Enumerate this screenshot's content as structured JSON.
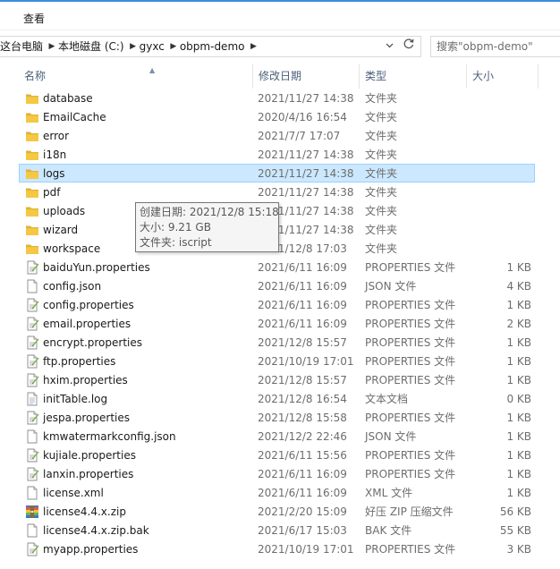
{
  "menubar": {
    "view_label": "查看"
  },
  "address_bar": {
    "crumbs": [
      "这台电脑",
      "本地磁盘 (C:)",
      "gyxc",
      "obpm-demo"
    ]
  },
  "search": {
    "placeholder": "搜索\"obpm-demo\""
  },
  "columns": {
    "name": "名称",
    "date": "修改日期",
    "type": "类型",
    "size": "大小"
  },
  "files": [
    {
      "name": "database",
      "date": "2021/11/27 14:38",
      "type": "文件夹",
      "size": "",
      "icon": "folder-icon"
    },
    {
      "name": "EmailCache",
      "date": "2020/4/16 16:54",
      "type": "文件夹",
      "size": "",
      "icon": "folder-icon"
    },
    {
      "name": "error",
      "date": "2021/7/7 17:07",
      "type": "文件夹",
      "size": "",
      "icon": "folder-icon"
    },
    {
      "name": "i18n",
      "date": "2021/11/27 14:38",
      "type": "文件夹",
      "size": "",
      "icon": "folder-icon"
    },
    {
      "name": "logs",
      "date": "2021/11/27 14:38",
      "type": "文件夹",
      "size": "",
      "icon": "folder-icon",
      "selected": true
    },
    {
      "name": "pdf",
      "date": "2021/11/27 14:38",
      "type": "文件夹",
      "size": "",
      "icon": "folder-icon"
    },
    {
      "name": "uploads",
      "date": "2021/11/27 14:38",
      "type": "文件夹",
      "size": "",
      "icon": "folder-icon"
    },
    {
      "name": "wizard",
      "date": "2021/11/27 14:38",
      "type": "文件夹",
      "size": "",
      "icon": "folder-icon"
    },
    {
      "name": "workspace",
      "date": "2021/12/8 17:03",
      "type": "文件夹",
      "size": "",
      "icon": "folder-icon"
    },
    {
      "name": "baiduYun.properties",
      "date": "2021/6/11 16:09",
      "type": "PROPERTIES 文件",
      "size": "1 KB",
      "icon": "properties-file-icon"
    },
    {
      "name": "config.json",
      "date": "2021/6/11 16:09",
      "type": "JSON 文件",
      "size": "4 KB",
      "icon": "blank-file-icon"
    },
    {
      "name": "config.properties",
      "date": "2021/6/11 16:09",
      "type": "PROPERTIES 文件",
      "size": "1 KB",
      "icon": "properties-file-icon"
    },
    {
      "name": "email.properties",
      "date": "2021/6/11 16:09",
      "type": "PROPERTIES 文件",
      "size": "2 KB",
      "icon": "properties-file-icon"
    },
    {
      "name": "encrypt.properties",
      "date": "2021/12/8 15:57",
      "type": "PROPERTIES 文件",
      "size": "1 KB",
      "icon": "properties-file-icon"
    },
    {
      "name": "ftp.properties",
      "date": "2021/10/19 17:01",
      "type": "PROPERTIES 文件",
      "size": "1 KB",
      "icon": "properties-file-icon"
    },
    {
      "name": "hxim.properties",
      "date": "2021/12/8 15:57",
      "type": "PROPERTIES 文件",
      "size": "1 KB",
      "icon": "properties-file-icon"
    },
    {
      "name": "initTable.log",
      "date": "2021/12/8 16:54",
      "type": "文本文档",
      "size": "0 KB",
      "icon": "text-file-icon"
    },
    {
      "name": "jespa.properties",
      "date": "2021/12/8 15:58",
      "type": "PROPERTIES 文件",
      "size": "1 KB",
      "icon": "properties-file-icon"
    },
    {
      "name": "kmwatermarkconfig.json",
      "date": "2021/12/2 22:46",
      "type": "JSON 文件",
      "size": "1 KB",
      "icon": "blank-file-icon"
    },
    {
      "name": "kujiale.properties",
      "date": "2021/6/11 15:56",
      "type": "PROPERTIES 文件",
      "size": "1 KB",
      "icon": "properties-file-icon"
    },
    {
      "name": "lanxin.properties",
      "date": "2021/6/11 16:09",
      "type": "PROPERTIES 文件",
      "size": "1 KB",
      "icon": "properties-file-icon"
    },
    {
      "name": "license.xml",
      "date": "2021/6/11 16:09",
      "type": "XML 文件",
      "size": "1 KB",
      "icon": "blank-file-icon"
    },
    {
      "name": "license4.4.x.zip",
      "date": "2021/2/20 15:09",
      "type": "好压 ZIP 压缩文件",
      "size": "56 KB",
      "icon": "zip-archive-icon"
    },
    {
      "name": "license4.4.x.zip.bak",
      "date": "2021/6/17 15:03",
      "type": "BAK 文件",
      "size": "55 KB",
      "icon": "blank-file-icon"
    },
    {
      "name": "myapp.properties",
      "date": "2021/10/19 17:01",
      "type": "PROPERTIES 文件",
      "size": "3 KB",
      "icon": "properties-file-icon"
    }
  ],
  "tooltip": {
    "created": "创建日期: 2021/12/8 15:18",
    "size": "大小: 9.21 GB",
    "folders": "文件夹: iscript"
  },
  "colors": {
    "selection_bg": "#cce8ff",
    "selection_border": "#99d1ff",
    "folder_yellow": "#f4c842",
    "header_text": "#4c607a",
    "secondary_text": "#6d6d6d"
  }
}
